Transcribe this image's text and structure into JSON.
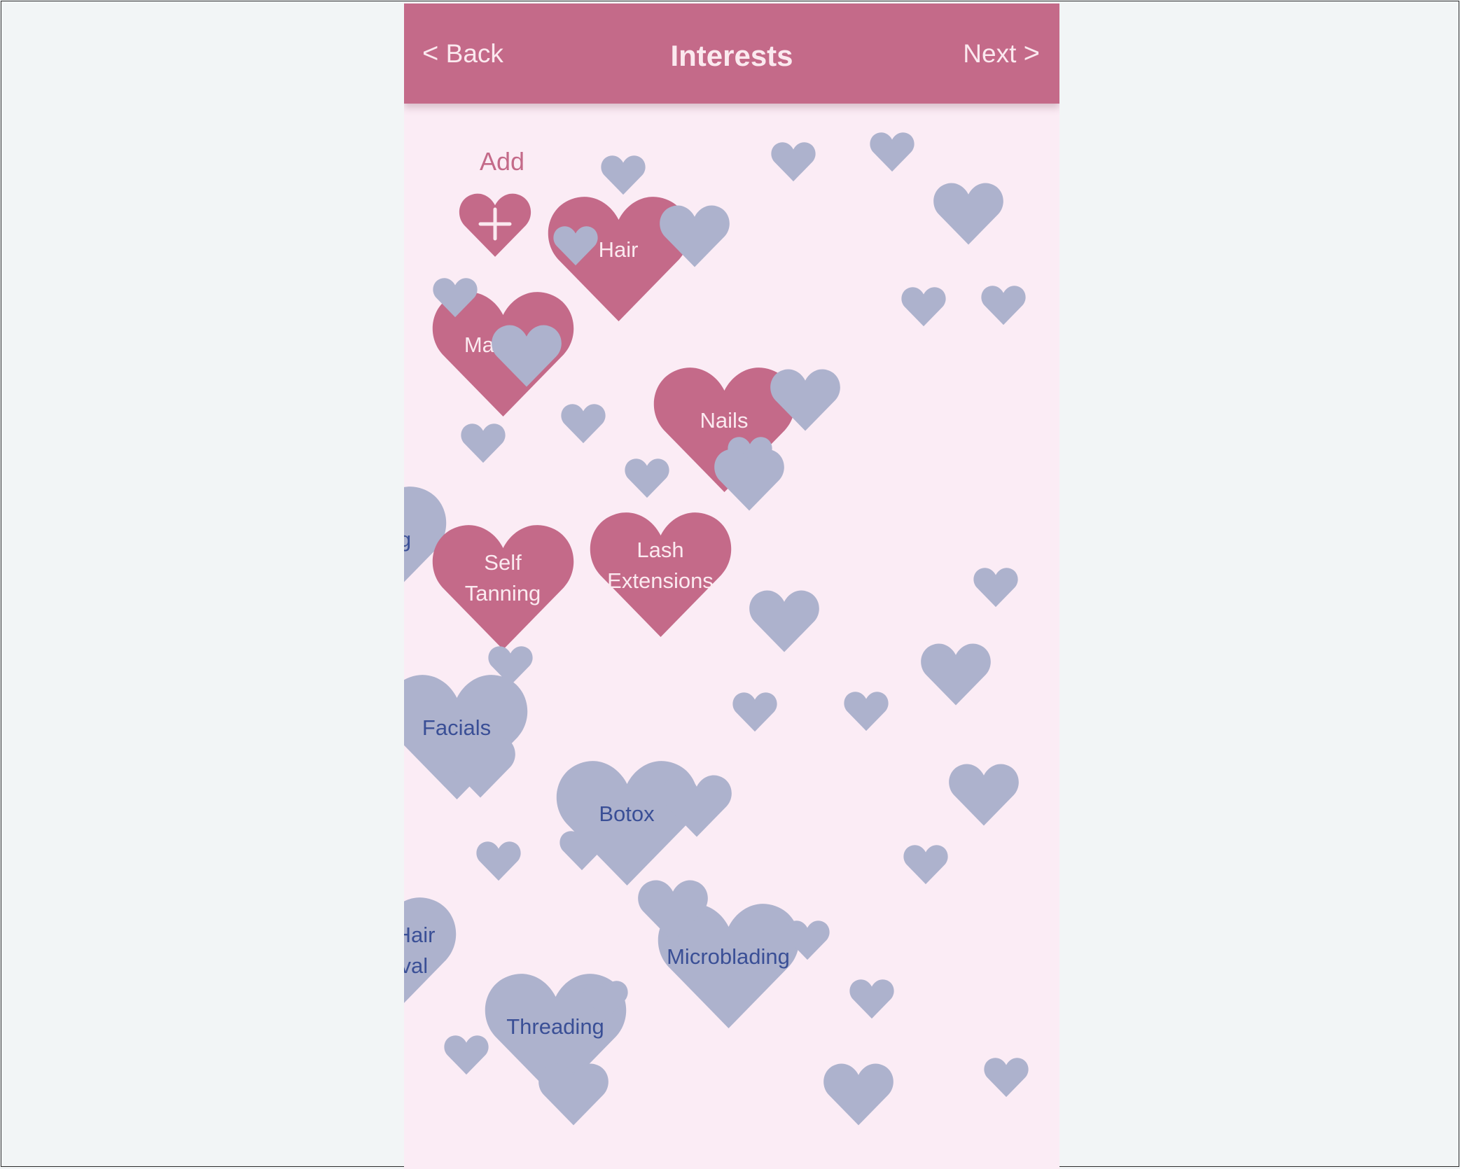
{
  "colors": {
    "navbar": "#c46a89",
    "selected_heart": "#c46a89",
    "unselected_heart": "#adb2cd",
    "background": "#fbecf5",
    "selected_text": "#fbeaf0",
    "unselected_text": "#3a4f96"
  },
  "header": {
    "back_chevron": "<",
    "back_label": "Back",
    "title": "Interests",
    "next_label": "Next",
    "next_chevron": ">"
  },
  "add": {
    "label": "Add",
    "icon": "plus-icon"
  },
  "interests": [
    {
      "id": "hair",
      "lines": [
        "Hair"
      ],
      "selected": true
    },
    {
      "id": "makeup",
      "lines": [
        "Makeup"
      ],
      "selected": true
    },
    {
      "id": "nails",
      "lines": [
        "Nails"
      ],
      "selected": true
    },
    {
      "id": "waxing",
      "lines": [
        "Waxing"
      ],
      "selected": false
    },
    {
      "id": "self-tanning",
      "lines": [
        "Self",
        "Tanning"
      ],
      "selected": true
    },
    {
      "id": "lash-extensions",
      "lines": [
        "Lash",
        "Extensions"
      ],
      "selected": true
    },
    {
      "id": "facials",
      "lines": [
        "Facials"
      ],
      "selected": false
    },
    {
      "id": "botox",
      "lines": [
        "Botox"
      ],
      "selected": false
    },
    {
      "id": "laser-hair-removal",
      "lines": [
        "Laser Hair",
        "Removal"
      ],
      "selected": false
    },
    {
      "id": "microblading",
      "lines": [
        "Microblading"
      ],
      "selected": false
    },
    {
      "id": "threading",
      "lines": [
        "Threading"
      ],
      "selected": false
    }
  ]
}
